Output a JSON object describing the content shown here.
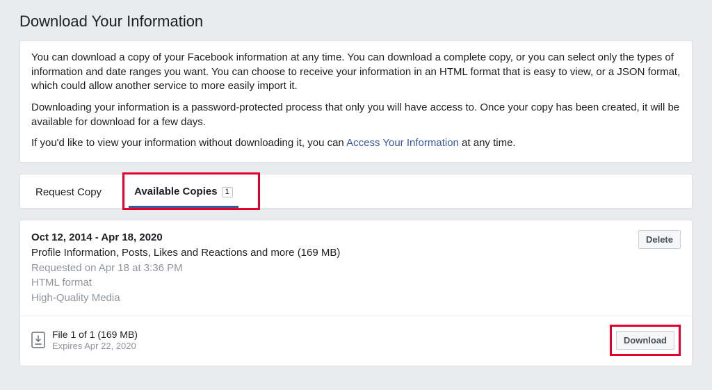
{
  "page_title": "Download Your Information",
  "intro": {
    "p1": "You can download a copy of your Facebook information at any time. You can download a complete copy, or you can select only the types of information and date ranges you want. You can choose to receive your information in an HTML format that is easy to view, or a JSON format, which could allow another service to more easily import it.",
    "p2": "Downloading your information is a password-protected process that only you will have access to. Once your copy has been created, it will be available for download for a few days.",
    "p3_pre": "If you'd like to view your information without downloading it, you can ",
    "p3_link": "Access Your Information",
    "p3_post": " at any time."
  },
  "tabs": {
    "request": "Request Copy",
    "available": "Available Copies",
    "badge": "1"
  },
  "copy": {
    "date_range": "Oct 12, 2014 - Apr 18, 2020",
    "desc": "Profile Information, Posts, Likes and Reactions and more (169 MB)",
    "requested": "Requested on Apr 18 at 3:36 PM",
    "format": "HTML format",
    "media": "High-Quality Media",
    "delete_btn": "Delete"
  },
  "file": {
    "title": "File 1 of 1 (169 MB)",
    "expires": "Expires Apr 22, 2020",
    "download_btn": "Download"
  }
}
